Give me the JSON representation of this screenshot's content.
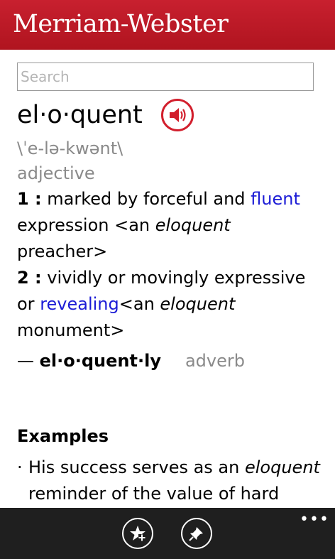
{
  "header": {
    "brand": "Merriam-Webster"
  },
  "search": {
    "placeholder": "Search"
  },
  "entry": {
    "headword": "el·o·quent",
    "pronunciation": "\\ˈe-lə-kwənt\\",
    "part_of_speech": "adjective",
    "definitions": [
      {
        "number": "1 :",
        "text_before": " marked by forceful and ",
        "link": "fluent",
        "text_after": " expression <an ",
        "example_word": "eloquent",
        "example_after": " preacher>"
      },
      {
        "number": "2 :",
        "text_before": " vividly or movingly expressive or ",
        "link": "revealing",
        "text_after": "<an ",
        "example_word": "eloquent",
        "example_after": " monument>"
      }
    ],
    "run_on": {
      "dash": "— ",
      "word": "el·o·quent·ly",
      "pos": "adverb"
    }
  },
  "examples": {
    "title": "Examples",
    "items": [
      {
        "bullet": "·",
        "before": "His success serves as an ",
        "word": "eloquent",
        "after": " reminder of the value of hard"
      }
    ]
  },
  "appbar": {
    "buttons": [
      {
        "icon": "favorite-star-add-icon"
      },
      {
        "icon": "pin-icon"
      }
    ],
    "more_label": "•••"
  },
  "colors": {
    "brand_red": "#c8202f",
    "link_blue": "#1c1cd6",
    "appbar": "#1f1f1f"
  }
}
